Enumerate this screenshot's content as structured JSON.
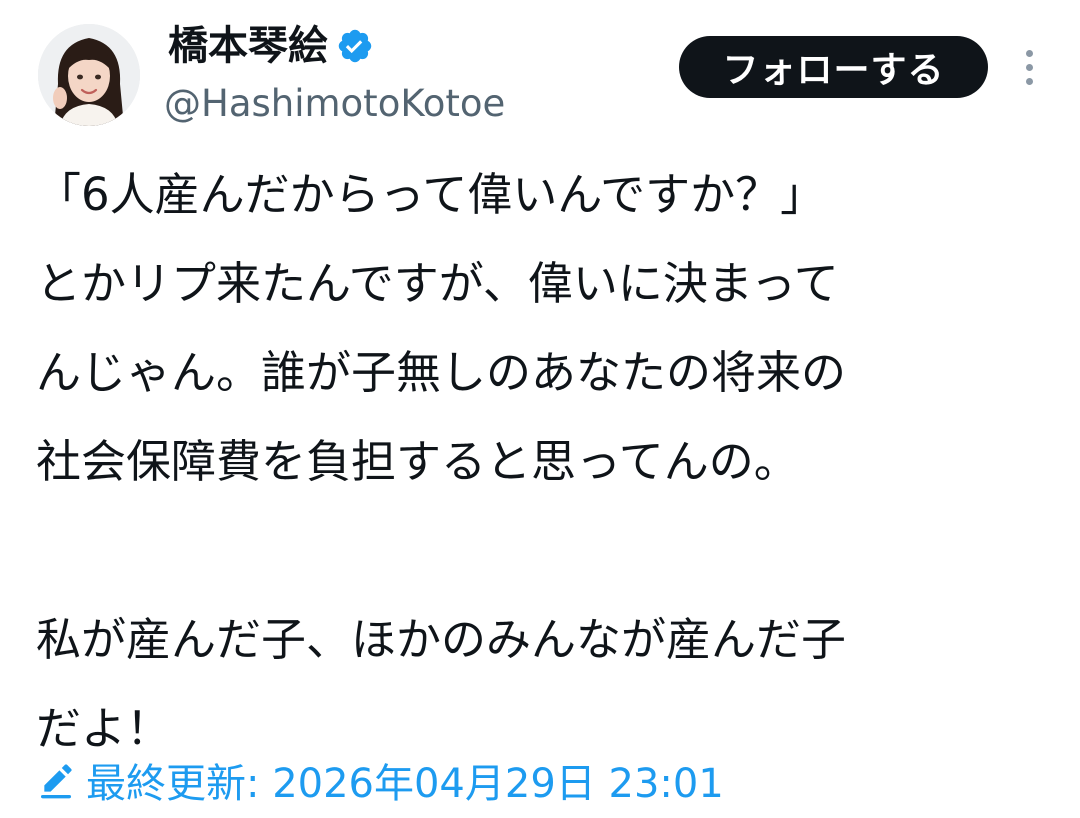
{
  "author": {
    "display_name": "橋本琴絵",
    "handle": "@HashimotoKotoe",
    "verified": true,
    "verified_badge_color": "#1d9bf0"
  },
  "actions": {
    "follow_label": "フォローする",
    "more_icon": "more-vertical-icon"
  },
  "tweet": {
    "lines": [
      "「6人産んだからって偉いんですか？」",
      "とかリプ来たんですが、偉いに決まって",
      "んじゃん。誰が子無しのあなたの将来の",
      "社会保障費を負担すると思ってんの。",
      "",
      "私が産んだ子、ほかのみんなが産んだ子",
      "だよ！"
    ]
  },
  "footer": {
    "edit_icon": "pencil-icon",
    "updated_text": "最終更新: 2026年04月29日 23:01",
    "accent_color": "#1d9bf0"
  }
}
